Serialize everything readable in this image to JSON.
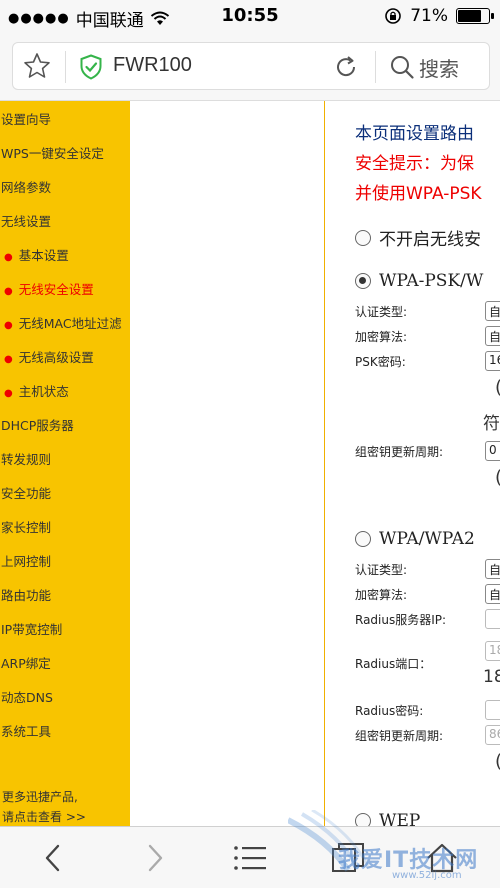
{
  "status_bar": {
    "carrier": "中国联通",
    "time": "10:55",
    "battery_percent": "71%",
    "battery_level": 0.71
  },
  "address_bar": {
    "url": "FWR100",
    "search_label": "搜索"
  },
  "sidebar": {
    "items": [
      {
        "label": "设置向导"
      },
      {
        "label": "WPS一键安全设定"
      },
      {
        "label": "网络参数"
      },
      {
        "label": "无线设置"
      },
      {
        "label": "基本设置"
      },
      {
        "label": "无线安全设置"
      },
      {
        "label": "无线MAC地址过滤"
      },
      {
        "label": "无线高级设置"
      },
      {
        "label": "主机状态"
      },
      {
        "label": "DHCP服务器"
      },
      {
        "label": "转发规则"
      },
      {
        "label": "安全功能"
      },
      {
        "label": "家长控制"
      },
      {
        "label": "上网控制"
      },
      {
        "label": "路由功能"
      },
      {
        "label": "IP带宽控制"
      },
      {
        "label": "ARP绑定"
      },
      {
        "label": "动态DNS"
      },
      {
        "label": "系统工具"
      }
    ],
    "more_line1": "更多迅捷产品,",
    "more_line2": "请点击查看 >>"
  },
  "main": {
    "intro": "本页面设置路由",
    "warning_line1": "安全提示：为保",
    "warning_line2": "并使用WPA-PSK",
    "option_off": "不开启无线安",
    "option_wpa_psk": "WPA-PSK/W",
    "psk": {
      "auth_type_label": "认证类型:",
      "auth_type_value": "自",
      "encryption_label": "加密算法:",
      "encryption_value": "自",
      "password_label": "PSK密码:",
      "password_value": "16",
      "paren1": "(",
      "fragment": "符",
      "group_key_label": "组密钥更新周期:",
      "group_key_value": "0",
      "paren2": "("
    },
    "option_wpa": "WPA/WPA2",
    "wpa": {
      "auth_type_label": "认证类型:",
      "auth_type_value": "自",
      "encryption_label": "加密算法:",
      "encryption_value": "自",
      "radius_ip_label": "Radius服务器IP:",
      "radius_port_label": "Radius端口：",
      "radius_port_value": "18",
      "radius_port_fragment": "18",
      "radius_password_label": "Radius密码:",
      "group_key_label": "组密钥更新周期:",
      "group_key_value": "86",
      "paren": "("
    },
    "option_wep": "WEP"
  },
  "watermark": {
    "text": "我爱IT技术网",
    "url": "www.52ij.com"
  },
  "colors": {
    "sidebar_bg": "#f8c400",
    "warning_red": "#e00000",
    "header_blue": "#0b2f7a",
    "shield_green": "#35b44a"
  }
}
